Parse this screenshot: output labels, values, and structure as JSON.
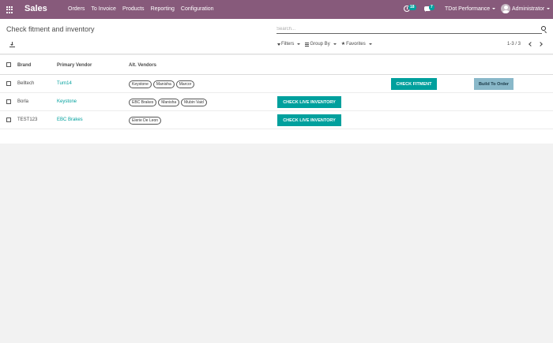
{
  "navbar": {
    "app_name": "Sales",
    "menu": [
      "Orders",
      "To Invoice",
      "Products",
      "Reporting",
      "Configuration"
    ],
    "activity_count": "18",
    "message_count": "7",
    "company": "TDot Performance",
    "user": "Administrator",
    "color": "#875a7b"
  },
  "control_panel": {
    "title": "Check fitment and inventory",
    "search_placeholder": "Search...",
    "filters_label": "Filters",
    "group_by_label": "Group By",
    "favorites_label": "Favorites",
    "pager": "1-3 / 3"
  },
  "list": {
    "columns": [
      "Brand",
      "Primary Vendor",
      "Alt. Vendors"
    ],
    "rows": [
      {
        "brand": "Belltech",
        "vendor": "Turn14",
        "alt_vendors": [
          "Keystone",
          "Manisha",
          "Marcor"
        ],
        "buttons": [
          "CHECK FITMENT",
          "Build To Order"
        ]
      },
      {
        "brand": "Borla",
        "vendor": "Keystone",
        "alt_vendors": [
          "EBC Brakes",
          "Manisha",
          "Mubin Vaid"
        ],
        "buttons": [
          "CHECK LIVE INVENTORY"
        ]
      },
      {
        "brand": "TEST123",
        "vendor": "EBC Brakes",
        "alt_vendors": [
          "Elerie De Leon"
        ],
        "buttons": [
          "CHECK LIVE INVENTORY"
        ]
      }
    ]
  },
  "colors": {
    "accent": "#00a09d",
    "secondary_button": "#89b8c9",
    "background": "#f2f2f2"
  }
}
